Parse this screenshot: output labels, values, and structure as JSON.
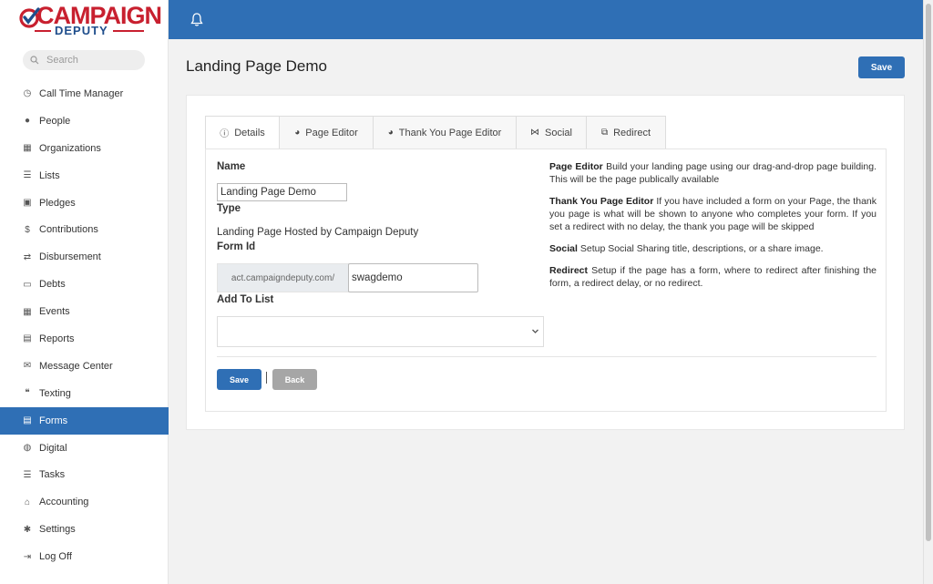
{
  "brand": {
    "main": "CAMPAIGN",
    "sub": "DEPUTY"
  },
  "search": {
    "placeholder": "Search"
  },
  "sidebar": {
    "items": [
      {
        "label": "Call Time Manager",
        "icon": "clock-icon",
        "glyph": "◷"
      },
      {
        "label": "People",
        "icon": "person-icon",
        "glyph": "●"
      },
      {
        "label": "Organizations",
        "icon": "building-icon",
        "glyph": "▦"
      },
      {
        "label": "Lists",
        "icon": "list-icon",
        "glyph": "☰"
      },
      {
        "label": "Pledges",
        "icon": "gift-icon",
        "glyph": "▣"
      },
      {
        "label": "Contributions",
        "icon": "dollar-icon",
        "glyph": "$"
      },
      {
        "label": "Disbursement",
        "icon": "exchange-icon",
        "glyph": "⇄"
      },
      {
        "label": "Debts",
        "icon": "money-icon",
        "glyph": "▭"
      },
      {
        "label": "Events",
        "icon": "calendar-icon",
        "glyph": "▦"
      },
      {
        "label": "Reports",
        "icon": "file-icon",
        "glyph": "▤"
      },
      {
        "label": "Message Center",
        "icon": "envelope-icon",
        "glyph": "✉"
      },
      {
        "label": "Texting",
        "icon": "comments-icon",
        "glyph": "❝"
      },
      {
        "label": "Forms",
        "icon": "form-icon",
        "glyph": "▤"
      },
      {
        "label": "Digital",
        "icon": "globe-icon",
        "glyph": "◍"
      },
      {
        "label": "Tasks",
        "icon": "tasks-icon",
        "glyph": "☰"
      },
      {
        "label": "Accounting",
        "icon": "bank-icon",
        "glyph": "⌂"
      },
      {
        "label": "Settings",
        "icon": "gear-icon",
        "glyph": "✱"
      },
      {
        "label": "Log Off",
        "icon": "logout-icon",
        "glyph": "⇥"
      }
    ],
    "active": "Forms"
  },
  "page": {
    "title": "Landing Page Demo",
    "save_label": "Save"
  },
  "tabs": [
    {
      "label": "Details",
      "icon": "info-icon",
      "glyph": "ⓘ"
    },
    {
      "label": "Page Editor",
      "icon": "palette-icon",
      "glyph": "◕"
    },
    {
      "label": "Thank You Page Editor",
      "icon": "palette-icon",
      "glyph": "◕"
    },
    {
      "label": "Social",
      "icon": "share-icon",
      "glyph": "⋈"
    },
    {
      "label": "Redirect",
      "icon": "external-link-icon",
      "glyph": "⧉"
    }
  ],
  "form": {
    "name_label": "Name",
    "name_value": "Landing Page Demo",
    "type_label": "Type",
    "type_value": "Landing Page Hosted by Campaign Deputy",
    "formid_label": "Form Id",
    "formid_prefix": "act.campaigndeputy.com/",
    "formid_value": "swagdemo",
    "addlist_label": "Add To List",
    "addlist_value": "",
    "save_label": "Save",
    "back_label": "Back"
  },
  "help": [
    {
      "title": "Page Editor",
      "text": "Build your landing page using our drag-and-drop page building. This will be the page publically available"
    },
    {
      "title": "Thank You Page Editor",
      "text": "If you have included a form on your Page, the thank you page is what will be shown to anyone who completes your form. If you set a redirect with no delay, the thank you page will be skipped"
    },
    {
      "title": "Social",
      "text": "Setup Social Sharing title, descriptions, or a share image."
    },
    {
      "title": "Redirect",
      "text": "Setup if the page has a form, where to redirect after finishing the form, a redirect delay, or no redirect."
    }
  ],
  "colors": {
    "primary": "#2f6fb5",
    "brand_red": "#c8202f",
    "brand_blue": "#1f4e8c",
    "back_button": "#a6a6a6"
  }
}
